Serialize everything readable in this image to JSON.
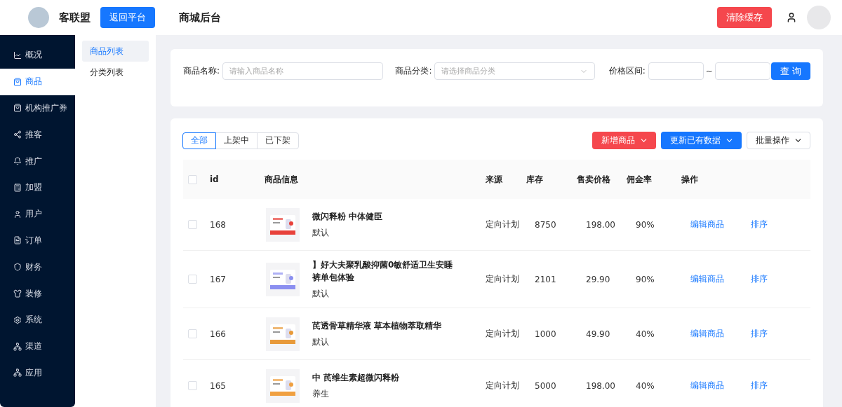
{
  "header": {
    "brand": "客联盟",
    "back_button": "返回平台",
    "title": "商城后台",
    "clear_button": "清除缓存"
  },
  "sidebar": {
    "items": [
      {
        "label": "概况",
        "selected": false
      },
      {
        "label": "商品",
        "selected": true
      },
      {
        "label": "机构推广券",
        "selected": false
      },
      {
        "label": "推客",
        "selected": false
      },
      {
        "label": "推广",
        "selected": false
      },
      {
        "label": "加盟",
        "selected": false
      },
      {
        "label": "用户",
        "selected": false
      },
      {
        "label": "订单",
        "selected": false
      },
      {
        "label": "财务",
        "selected": false
      },
      {
        "label": "装修",
        "selected": false
      },
      {
        "label": "系统",
        "selected": false
      },
      {
        "label": "渠道",
        "selected": false
      },
      {
        "label": "应用",
        "selected": false
      }
    ]
  },
  "submenu": {
    "items": [
      {
        "label": "商品列表",
        "selected": true
      },
      {
        "label": "分类列表",
        "selected": false
      }
    ]
  },
  "filters": {
    "name_label": "商品名称:",
    "name_placeholder": "请输入商品名称",
    "category_label": "商品分类:",
    "category_placeholder": "请选择商品分类",
    "price_label": "价格区间:",
    "range_sep": "~",
    "search_button": "查 询"
  },
  "tabs": [
    {
      "label": "全部",
      "selected": true
    },
    {
      "label": "上架中",
      "selected": false
    },
    {
      "label": "已下架",
      "selected": false
    }
  ],
  "actions": [
    {
      "label": "新增商品",
      "kind": "danger"
    },
    {
      "label": "更新已有数据",
      "kind": "primary"
    },
    {
      "label": "批量操作",
      "kind": "plain"
    }
  ],
  "table": {
    "header_checked": false,
    "columns": [
      "id",
      "商品信息",
      "来源",
      "库存",
      "售卖价格",
      "佣金率",
      "操作"
    ],
    "rows": [
      {
        "id": "168",
        "title": "微闪释粉 中体健臣",
        "tag": "默认",
        "source": "定向计划",
        "stock": "8750",
        "price": "198.00",
        "rate": "90%",
        "edit": "编辑商品",
        "sort": "排序",
        "checked": false
      },
      {
        "id": "167",
        "title": "】好大夫聚乳酸抑菌0敏舒适卫生安睡裤单包体验",
        "tag": "默认",
        "source": "定向计划",
        "stock": "2101",
        "price": "29.90",
        "rate": "90%",
        "edit": "编辑商品",
        "sort": "排序",
        "checked": false
      },
      {
        "id": "166",
        "title": "芪透骨草精华液 草本植物萃取精华",
        "tag": "默认",
        "source": "定向计划",
        "stock": "1000",
        "price": "49.90",
        "rate": "40%",
        "edit": "编辑商品",
        "sort": "排序",
        "checked": false
      },
      {
        "id": "165",
        "title": "中 芪维生素超微闪释粉",
        "tag": "养生",
        "source": "定向计划",
        "stock": "5000",
        "price": "198.00",
        "rate": "40%",
        "edit": "编辑商品",
        "sort": "排序",
        "checked": false
      }
    ]
  }
}
